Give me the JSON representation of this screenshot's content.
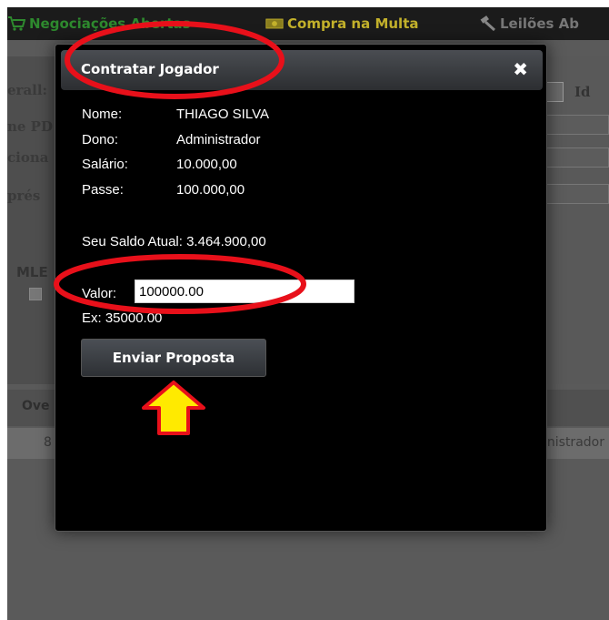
{
  "background": {
    "nav": [
      {
        "label": "Negociações Abertas",
        "icon": "cart-icon"
      },
      {
        "label": "Compra na Multa",
        "icon": "money-icon"
      },
      {
        "label": "Leilões Ab",
        "icon": "gavel-icon"
      }
    ],
    "side_labels": [
      "erall:",
      "ne PD",
      "ciona",
      "prés"
    ],
    "id_label": "Id",
    "mle_label": "MLE",
    "table": {
      "header_cell": "Ove",
      "row_first": "8",
      "row_last": "inistrador"
    }
  },
  "modal": {
    "title": "Contratar Jogador",
    "close_symbol": "✖",
    "fields": [
      {
        "label": "Nome:",
        "value": "THIAGO SILVA"
      },
      {
        "label": "Dono:",
        "value": "Administrador"
      },
      {
        "label": "Salário:",
        "value": "10.000,00"
      },
      {
        "label": "Passe:",
        "value": "100.000,00"
      }
    ],
    "balance": "Seu Saldo Atual: 3.464.900,00",
    "valor_label": "Valor:",
    "valor_value": "100000.00",
    "example": "Ex: 35000.00",
    "send_button": "Enviar Proposta"
  },
  "colors": {
    "annotation_red": "#e8101a",
    "arrow_yellow": "#ffea00"
  }
}
